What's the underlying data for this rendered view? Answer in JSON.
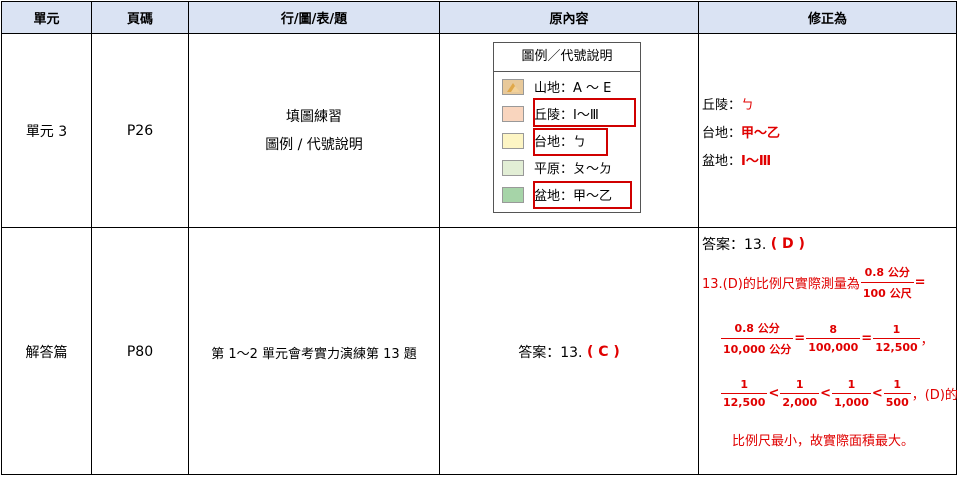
{
  "headers": [
    "單元",
    "頁碼",
    "行/圖/表/題",
    "原內容",
    "修正為"
  ],
  "row1": {
    "unit": "單元 3",
    "page": "P26",
    "item_line1": "填圖練習",
    "item_line2": "圖例 / 代號說明",
    "legend": {
      "title": "圖例／代號說明",
      "rows": [
        {
          "label": "山地：A ～ E",
          "color": "#e8c99a"
        },
        {
          "label": "丘陵：Ⅰ～Ⅲ",
          "color": "#f9d5be"
        },
        {
          "label": "台地：ㄅ",
          "color": "#fdf5c4"
        },
        {
          "label": "平原：ㄆ～ㄉ",
          "color": "#e2eed5"
        },
        {
          "label": "盆地：甲～乙",
          "color": "#a6d4a8"
        }
      ]
    },
    "fix": [
      {
        "prefix": "丘陵：",
        "value": "ㄅ"
      },
      {
        "prefix": "台地：",
        "value": "甲～乙"
      },
      {
        "prefix": "盆地：",
        "value": "Ⅰ～Ⅲ"
      }
    ]
  },
  "row2": {
    "unit": "解答篇",
    "page": "P80",
    "item": "第 1～2 單元會考實力演練第 13 題",
    "orig_prefix": "答案：13.",
    "orig_value": "( C )",
    "fix": {
      "answer_prefix": "答案：13.",
      "answer_value": "( D )",
      "line1_text": "13.(D)的比例尺實際測量為",
      "f1_num": "0.8 公分",
      "f1_den": "100 公尺",
      "eq": "=",
      "f2_num": "0.8 公分",
      "f2_den": "10,000 公分",
      "f3_num": "8",
      "f3_den": "100,000",
      "f4_num": "1",
      "f4_den": "12,500",
      "comma": "，",
      "lt": "<",
      "f5_num": "1",
      "f5_den": "12,500",
      "f6_num": "1",
      "f6_den": "2,000",
      "f7_num": "1",
      "f7_den": "1,000",
      "f8_num": "1",
      "f8_den": "500",
      "line3_tail": "，(D)的",
      "line4": "比例尺最小，故實際面積最大。"
    }
  }
}
